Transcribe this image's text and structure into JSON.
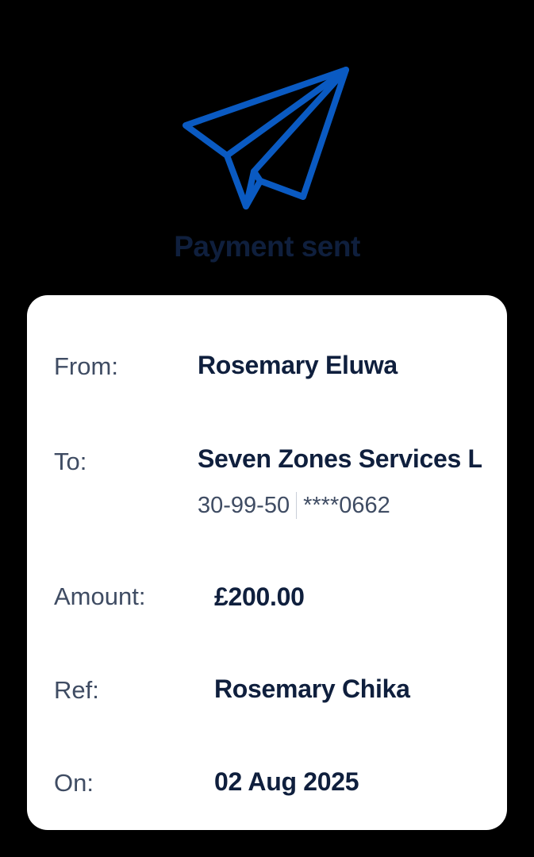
{
  "status": {
    "title": "Payment sent",
    "icon": "paper-plane-icon",
    "icon_color": "#0a5ac2"
  },
  "details": {
    "from": {
      "label": "From:",
      "value": "Rosemary Eluwa"
    },
    "to": {
      "label": "To:",
      "value": "Seven Zones Services Ltd",
      "sort_code": "30-99-50",
      "account": "****0662"
    },
    "amount": {
      "label": "Amount:",
      "value": "£200.00"
    },
    "ref": {
      "label": "Ref:",
      "value": "Rosemary Chika"
    },
    "on": {
      "label": "On:",
      "value": "02 Aug 2025"
    }
  },
  "colors": {
    "background": "#000000",
    "card": "#ffffff",
    "primary_text": "#0f1f3d",
    "secondary_text": "#3f4c63"
  }
}
